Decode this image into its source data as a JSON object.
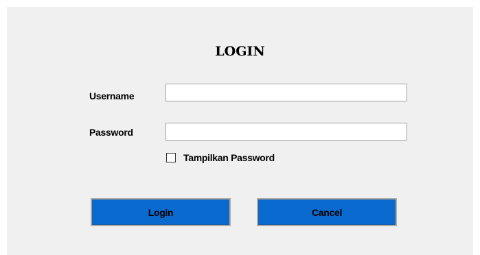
{
  "form": {
    "title": "LOGIN",
    "username": {
      "label": "Username",
      "value": ""
    },
    "password": {
      "label": "Password",
      "value": ""
    },
    "show_password": {
      "label": "Tampilkan Password",
      "checked": false
    },
    "buttons": {
      "login": "Login",
      "cancel": "Cancel"
    }
  },
  "colors": {
    "background": "#f0f0f0",
    "button_fill": "#0a6ad0",
    "button_border": "#ababab"
  }
}
